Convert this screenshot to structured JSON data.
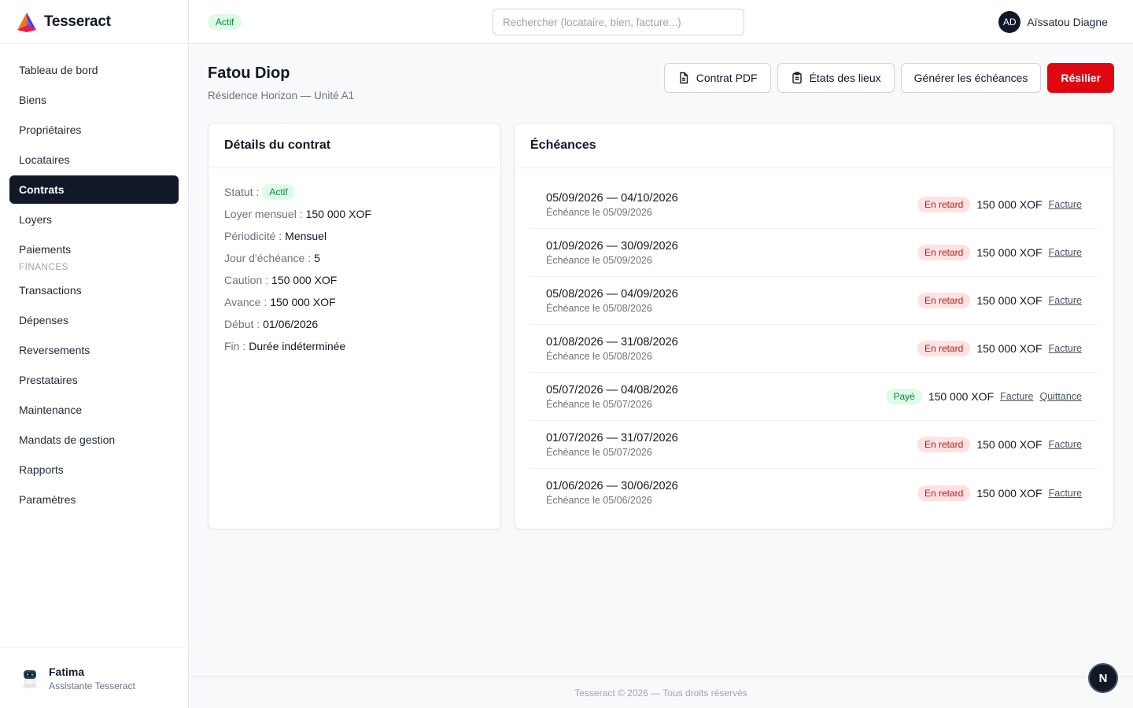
{
  "brand": {
    "name": "Tesseract"
  },
  "sidebar": {
    "items": [
      {
        "label": "Tableau de bord"
      },
      {
        "label": "Biens"
      },
      {
        "label": "Propriétaires"
      },
      {
        "label": "Locataires"
      },
      {
        "label": "Contrats",
        "active": true
      },
      {
        "label": "Loyers"
      },
      {
        "label": "Paiements"
      }
    ],
    "section_label": "FINANCES",
    "finance_items": [
      {
        "label": "Transactions"
      },
      {
        "label": "Dépenses"
      },
      {
        "label": "Reversements"
      },
      {
        "label": "Prestataires"
      },
      {
        "label": "Maintenance"
      },
      {
        "label": "Mandats de gestion"
      },
      {
        "label": "Rapports"
      },
      {
        "label": "Paramètres"
      }
    ],
    "assistant": {
      "name": "Fatima",
      "role": "Assistante Tesseract"
    }
  },
  "topbar": {
    "status_badge": "Actif",
    "search_placeholder": "Rechercher (locataire, bien, facture...)",
    "user": {
      "initials": "AD",
      "name": "Aïssatou Diagne"
    }
  },
  "page": {
    "title": "Fatou Diop",
    "subtitle": "Résidence Horizon — Unité A1",
    "actions": {
      "contract_pdf": "Contrat PDF",
      "inventory": "États des lieux",
      "generate": "Générer les échéances",
      "terminate": "Résilier"
    }
  },
  "details": {
    "title": "Détails du contrat",
    "status_label": "Statut :",
    "status_value": "Actif",
    "rows": [
      {
        "label": "Loyer mensuel :",
        "value": "150 000 XOF"
      },
      {
        "label": "Périodicité :",
        "value": "Mensuel"
      },
      {
        "label": "Jour d'échéance :",
        "value": "5"
      },
      {
        "label": "Caution :",
        "value": "150 000 XOF"
      },
      {
        "label": "Avance :",
        "value": "150 000 XOF"
      },
      {
        "label": "Début :",
        "value": "01/06/2026"
      },
      {
        "label": "Fin :",
        "value": "Durée indéterminée"
      }
    ]
  },
  "schedules": {
    "title": "Échéances",
    "rows": [
      {
        "period": "05/09/2026 — 04/10/2026",
        "due": "Échéance le 05/09/2026",
        "status": "En retard",
        "status_type": "late",
        "amount": "150 000 XOF",
        "invoice": "Facture"
      },
      {
        "period": "01/09/2026 — 30/09/2026",
        "due": "Échéance le 05/09/2026",
        "status": "En retard",
        "status_type": "late",
        "amount": "150 000 XOF",
        "invoice": "Facture"
      },
      {
        "period": "05/08/2026 — 04/09/2026",
        "due": "Échéance le 05/08/2026",
        "status": "En retard",
        "status_type": "late",
        "amount": "150 000 XOF",
        "invoice": "Facture"
      },
      {
        "period": "01/08/2026 — 31/08/2026",
        "due": "Échéance le 05/08/2026",
        "status": "En retard",
        "status_type": "late",
        "amount": "150 000 XOF",
        "invoice": "Facture"
      },
      {
        "period": "05/07/2026 — 04/08/2026",
        "due": "Échéance le 05/07/2026",
        "status": "Payé",
        "status_type": "paid",
        "amount": "150 000 XOF",
        "invoice": "Facture",
        "receipt": "Quittance"
      },
      {
        "period": "01/07/2026 — 31/07/2026",
        "due": "Échéance le 05/07/2026",
        "status": "En retard",
        "status_type": "late",
        "amount": "150 000 XOF",
        "invoice": "Facture"
      },
      {
        "period": "01/06/2026 — 30/06/2026",
        "due": "Échéance le 05/06/2026",
        "status": "En retard",
        "status_type": "late",
        "amount": "150 000 XOF",
        "invoice": "Facture"
      }
    ]
  },
  "footer": {
    "text": "Tesseract © 2026 — Tous droits réservés"
  },
  "fab": {
    "label": "N"
  },
  "colors": {
    "accent_danger": "#e00610",
    "sidebar_active": "#111827",
    "paid_bg": "#dcfce7",
    "late_bg": "#fee2e2"
  }
}
